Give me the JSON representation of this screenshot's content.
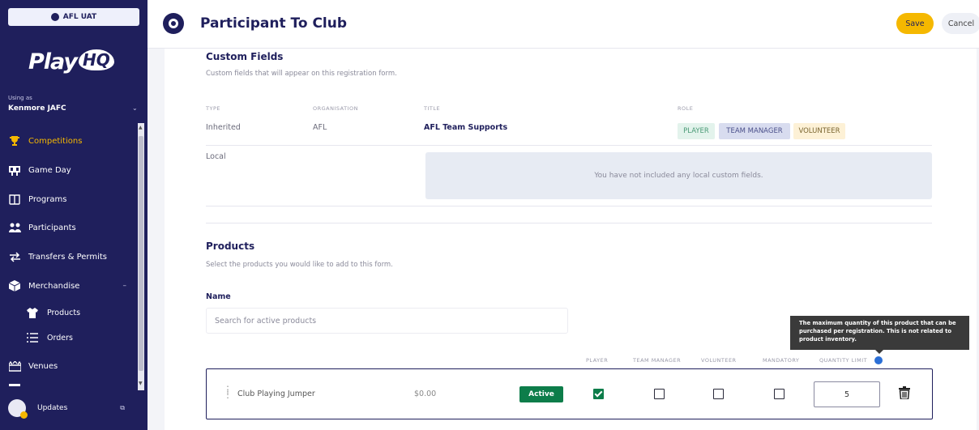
{
  "sidebar": {
    "env_badge": "AFL UAT",
    "logo_play": "Play",
    "logo_hq": "HQ",
    "using_as_label": "Using as",
    "org_name": "Kenmore JAFC",
    "items": [
      {
        "label": "Competitions",
        "icon": "trophy-icon"
      },
      {
        "label": "Game Day",
        "icon": "scoreboard-icon"
      },
      {
        "label": "Programs",
        "icon": "book-icon"
      },
      {
        "label": "Participants",
        "icon": "people-icon"
      },
      {
        "label": "Transfers & Permits",
        "icon": "transfer-icon"
      },
      {
        "label": "Merchandise",
        "icon": "box-icon"
      },
      {
        "label": "Products",
        "icon": "shirt-icon"
      },
      {
        "label": "Orders",
        "icon": "list-icon"
      },
      {
        "label": "Venues",
        "icon": "stadium-icon"
      }
    ],
    "updates_label": "Updates"
  },
  "header": {
    "title": "Participant To Club",
    "save_label": "Save",
    "cancel_label": "Cancel"
  },
  "custom_fields": {
    "title": "Custom Fields",
    "subtitle": "Custom fields that will appear on this registration form.",
    "columns": [
      "TYPE",
      "ORGANISATION",
      "TITLE",
      "ROLE"
    ],
    "inherited_row": {
      "type": "Inherited",
      "organisation": "AFL",
      "title": "AFL Team Supports",
      "roles": [
        "PLAYER",
        "TEAM MANAGER",
        "VOLUNTEER"
      ]
    },
    "local_label": "Local",
    "empty_message": "You have not included any local custom fields."
  },
  "products": {
    "title": "Products",
    "subtitle": "Select the products you would like to add to this form.",
    "name_label": "Name",
    "search_placeholder": "Search for active products",
    "tooltip": "The maximum quantity of this product that can be purchased per registration. This is not related to product inventory.",
    "tooltip_line1": "The maximum quantity of this product that can be",
    "tooltip_line2": "purchased per registration. This is not related to",
    "tooltip_line3": "product inventory.",
    "columns": [
      "PLAYER",
      "TEAM MANAGER",
      "VOLUNTEER",
      "MANDATORY",
      "QUANTITY LIMIT"
    ],
    "row": {
      "name": "Club Playing Jumper",
      "price": "$0.00",
      "status": "Active",
      "player": true,
      "team_manager": false,
      "volunteer": false,
      "mandatory": false,
      "quantity_limit": "5"
    }
  },
  "colors": {
    "sidebar_bg": "#1f1f5c",
    "accent": "#f5b800",
    "active_green": "#0d7d4a",
    "player_role_bg": "#e3f3ec",
    "team_manager_role_bg": "#d8dcef",
    "volunteer_role_bg": "#fdf1d6"
  }
}
